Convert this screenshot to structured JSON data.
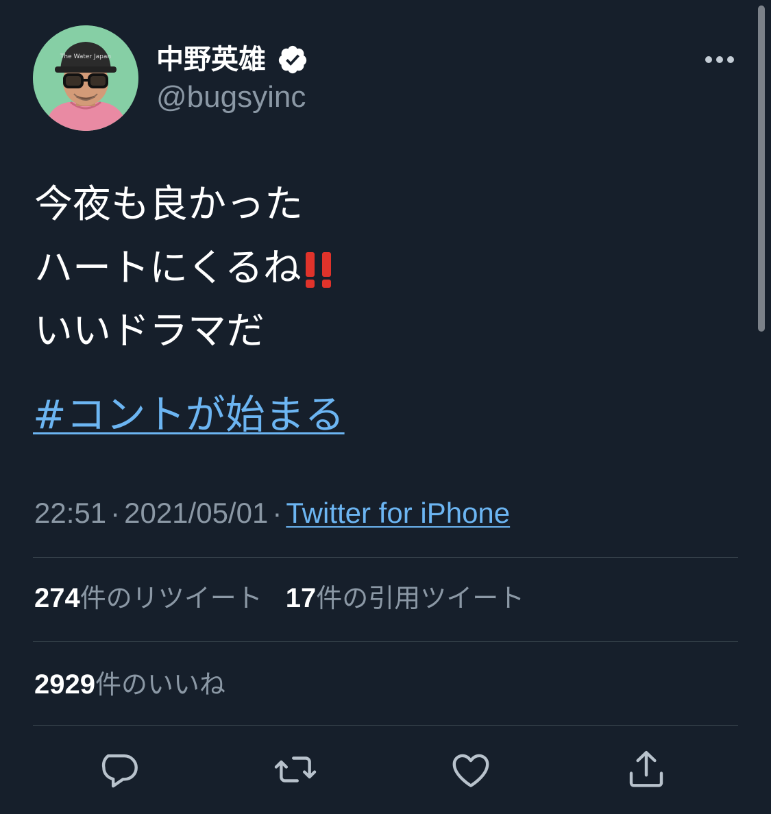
{
  "user": {
    "display_name": "中野英雄",
    "handle": "@bugsyinc",
    "verified": true,
    "avatar_cap_text": "The Water Japan"
  },
  "tweet": {
    "lines": [
      "今夜も良かった",
      "ハートにくるね",
      "いいドラマだ"
    ],
    "emoji_after_line_2": "double-exclamation-mark",
    "hashtag": "#コントが始まる"
  },
  "meta": {
    "time": "22:51",
    "separator": "·",
    "date": "2021/05/01",
    "source": "Twitter for iPhone"
  },
  "stats": {
    "retweets_count": "274",
    "retweets_label": "件のリツイート",
    "quotes_count": "17",
    "quotes_label": "件の引用ツイート",
    "likes_count": "2929",
    "likes_label": "件のいいね"
  },
  "icons": {
    "more": "more-horizontal-icon",
    "verified": "verified-badge-icon",
    "reply": "reply-icon",
    "retweet": "retweet-icon",
    "like": "heart-icon",
    "share": "share-icon"
  },
  "colors": {
    "background": "#161f2b",
    "link": "#6cb5f2",
    "secondary_text": "#8b98a5",
    "divider": "#38444d",
    "emoji_red": "#e0332b"
  }
}
